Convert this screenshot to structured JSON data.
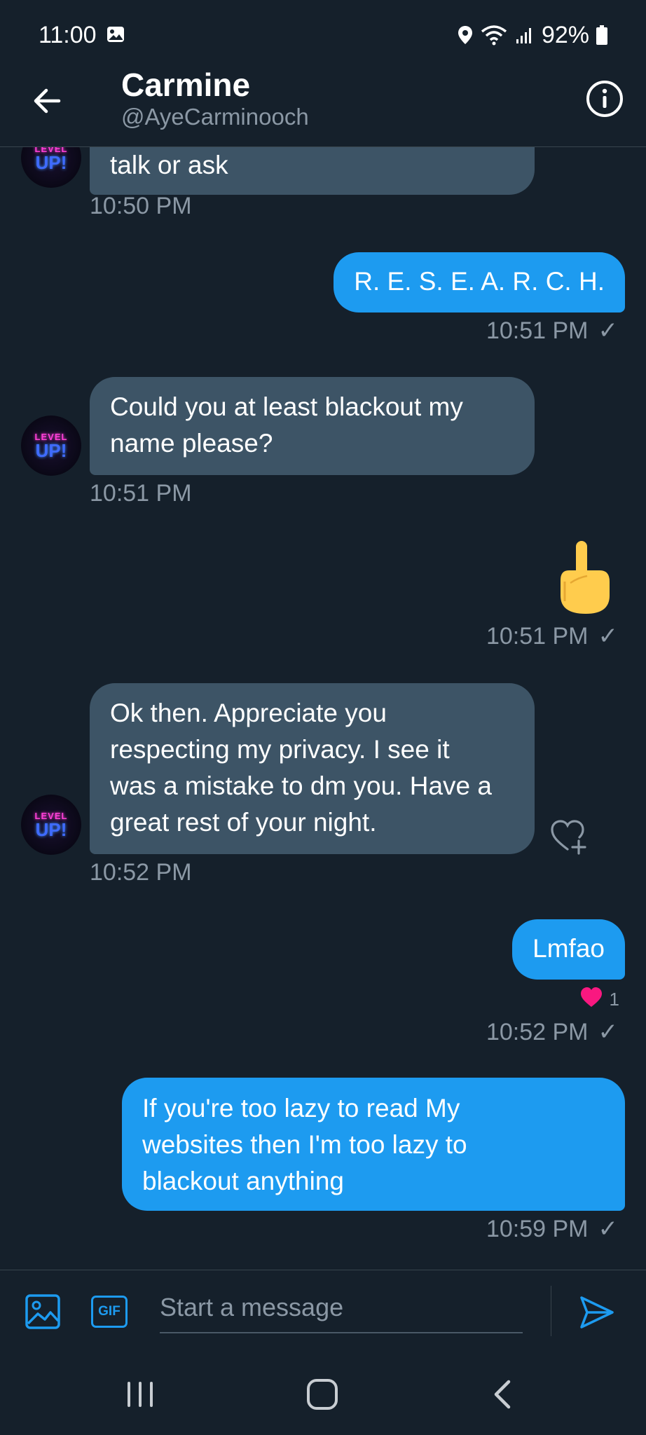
{
  "status": {
    "time": "11:00",
    "battery": "92%"
  },
  "header": {
    "name": "Carmine",
    "handle": "@AyeCarminooch"
  },
  "avatar": {
    "line1": "LEVEL",
    "line2": "UP!"
  },
  "messages": {
    "m1_text": "talk or ask",
    "m1_time": "10:50 PM",
    "m2_text": "R. E. S. E. A. R. C. H.",
    "m2_time": "10:51 PM",
    "m3_line1": "Could you at least blackout my",
    "m3_line2": "name please?",
    "m3_time": "10:51 PM",
    "m4_emoji": "🖕",
    "m4_time": "10:51 PM",
    "m5_line1": "Ok then. Appreciate you",
    "m5_line2": "respecting my privacy. I see it",
    "m5_line3": "was a mistake to dm you. Have a",
    "m5_line4": "great rest of your night.",
    "m5_time": "10:52 PM",
    "m6_text": "Lmfao",
    "m6_reaction_count": "1",
    "m6_time": "10:52 PM",
    "m7_line1": "If you're too lazy to read My",
    "m7_line2": "websites then I'm too lazy to",
    "m7_line3": "blackout anything",
    "m7_time": "10:59 PM",
    "read_mark": "✓"
  },
  "composer": {
    "placeholder": "Start a message",
    "gif_label": "GIF"
  },
  "colors": {
    "accent": "#1d9bf0",
    "background": "#15202b",
    "incoming_bubble": "#3d5466",
    "muted": "#8b98a5",
    "heart": "#f91880"
  },
  "icons": [
    "back-arrow-icon",
    "info-icon",
    "image-icon",
    "gif-icon",
    "send-icon",
    "heart-add-icon",
    "heart-icon",
    "location-icon",
    "wifi-icon",
    "signal-icon",
    "battery-icon",
    "gallery-icon"
  ]
}
